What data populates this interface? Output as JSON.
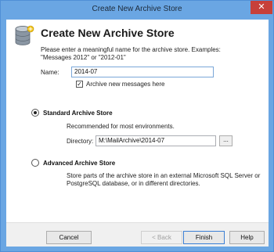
{
  "window": {
    "title": "Create New Archive Store",
    "close_symbol": "✕"
  },
  "header": {
    "icon": "database-icon",
    "title": "Create New Archive Store",
    "intro": "Please enter a meaningful name for the archive store. Examples: \"Messages 2012\" or \"2012-01\""
  },
  "name_field": {
    "label": "Name:",
    "value": "2014-07"
  },
  "archive_checkbox": {
    "label": "Archive new messages here",
    "checked": true,
    "check_symbol": "✓"
  },
  "standard": {
    "label": "Standard Archive Store",
    "selected": true,
    "description": "Recommended for most environments.",
    "directory_label": "Directory:",
    "directory_value": "M:\\MailArchive\\2014-07",
    "browse_label": "..."
  },
  "advanced": {
    "label": "Advanced Archive Store",
    "selected": false,
    "description_line1": "Store parts of the archive store in an external Microsoft SQL Server or",
    "description_line2": "PostgreSQL database, or in different directories."
  },
  "buttons": {
    "cancel": "Cancel",
    "back": "< Back",
    "finish": "Finish",
    "help": "Help"
  },
  "colors": {
    "titlebar": "#6aa6e3",
    "close": "#c7403a",
    "accent": "#3c7fd4"
  }
}
